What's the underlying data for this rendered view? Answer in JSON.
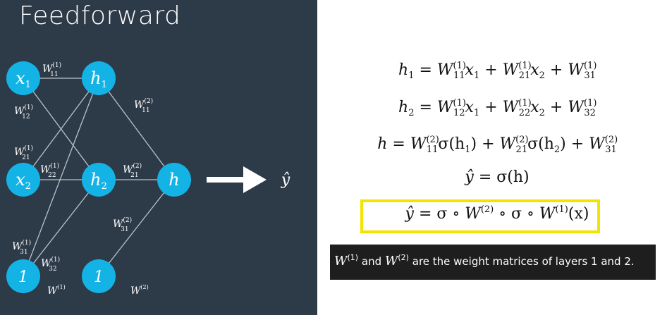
{
  "slide": {
    "title": "Feedforward",
    "nodes": {
      "x1": {
        "base": "x",
        "sub": "1"
      },
      "x2": {
        "base": "x",
        "sub": "2"
      },
      "b1": {
        "base": "1",
        "sub": ""
      },
      "h1": {
        "base": "h",
        "sub": "1"
      },
      "h2": {
        "base": "h",
        "sub": "2"
      },
      "b2": {
        "base": "1",
        "sub": ""
      },
      "h": {
        "base": "h",
        "sub": ""
      }
    },
    "weights": {
      "w11_1": {
        "sup": "(1)",
        "sub": "11"
      },
      "w12_1": {
        "sup": "(1)",
        "sub": "12"
      },
      "w21_1": {
        "sup": "(1)",
        "sub": "21"
      },
      "w22_1": {
        "sup": "(1)",
        "sub": "22"
      },
      "w31_1": {
        "sup": "(1)",
        "sub": "31"
      },
      "w32_1": {
        "sup": "(1)",
        "sub": "32"
      },
      "w11_2": {
        "sup": "(2)",
        "sub": "11"
      },
      "w21_2": {
        "sup": "(2)",
        "sub": "21"
      },
      "w31_2": {
        "sup": "(2)",
        "sub": "31"
      },
      "layer1": {
        "sup": "(1)",
        "sub": ""
      },
      "layer2": {
        "sup": "(2)",
        "sub": ""
      }
    },
    "output_symbol": "ŷ",
    "colors": {
      "background": "#2d3a48",
      "node": "#14b3e6",
      "edge": "#b8c2cc",
      "arrow": "#ffffff"
    }
  },
  "equations": {
    "eq1": {
      "lhs": "h",
      "lhs_sub": "1",
      "t1": "W",
      "t1_sup": "(1)",
      "t1_sub": "11",
      "t1_var": "x",
      "t1_var_sub": "1",
      "t2": "W",
      "t2_sup": "(1)",
      "t2_sub": "21",
      "t2_var": "x",
      "t2_var_sub": "2",
      "t3": "W",
      "t3_sup": "(1)",
      "t3_sub": "31"
    },
    "eq2": {
      "lhs": "h",
      "lhs_sub": "2",
      "t1": "W",
      "t1_sup": "(1)",
      "t1_sub": "12",
      "t1_var": "x",
      "t1_var_sub": "1",
      "t2": "W",
      "t2_sup": "(1)",
      "t2_sub": "22",
      "t2_var": "x",
      "t2_var_sub": "2",
      "t3": "W",
      "t3_sup": "(1)",
      "t3_sub": "32"
    },
    "eq3": {
      "lhs": "h",
      "t1": "W",
      "t1_sup": "(2)",
      "t1_sub": "11",
      "t1_fn": "σ(h",
      "t1_fn_sub": "1",
      "t1_fn_end": ")",
      "t2": "W",
      "t2_sup": "(2)",
      "t2_sub": "21",
      "t2_fn": "σ(h",
      "t2_fn_sub": "2",
      "t2_fn_end": ")",
      "t3": "W",
      "t3_sup": "(2)",
      "t3_sub": "31"
    },
    "eq4": {
      "lhs": "ŷ",
      "rhs": "σ(h)"
    },
    "eq5": {
      "lhs": "ŷ",
      "p1": "σ ∘ ",
      "w1": "W",
      "w1_sup": "(2)",
      "p2": " ∘ σ ∘ ",
      "w2": "W",
      "w2_sup": "(1)",
      "p3": "(x)",
      "highlight_color": "#f2e400"
    }
  },
  "caption": {
    "w1": "W",
    "w1_sup": "(1)",
    "and": " and ",
    "w2": "W",
    "w2_sup": "(2)",
    "rest": " are the weight matrices of layers 1 and 2."
  }
}
